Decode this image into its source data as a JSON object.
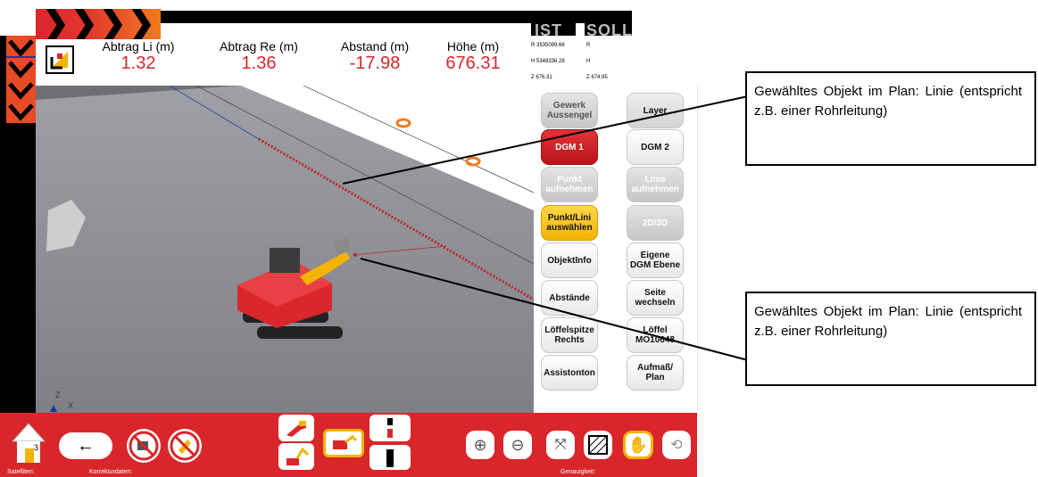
{
  "header": {
    "abtrag_li_label": "Abtrag Li (m)",
    "abtrag_li_value": "1.32",
    "abtrag_re_label": "Abtrag Re (m)",
    "abtrag_re_value": "1.36",
    "abstand_label": "Abstand (m)",
    "abstand_value": "-17.98",
    "hoehe_label": "Höhe (m)",
    "hoehe_value": "676.31"
  },
  "ist_soll": {
    "ist_label": "IST",
    "soll_label": "SOLL",
    "ist_r": "R 3535099.66",
    "ist_h": "H 5348336.28",
    "ist_z": "Z 676.31",
    "soll_r": "R",
    "soll_h": "H",
    "soll_z": "Z 674.95"
  },
  "view": {
    "axis_z": "Z",
    "axis_x": "X"
  },
  "panel": {
    "gewerk": "Gewerk Aussengel",
    "layer": "Layer",
    "dgm1": "DGM 1",
    "dgm2": "DGM 2",
    "punkt_aufnehmen": "Punkt aufnehmen",
    "linie_aufnehmen": "Linie aufnehmen",
    "punkt_linie": "Punkt/Lini auswählen",
    "view_2d3d": "2D/3D",
    "objektinfo": "ObjektInfo",
    "eigene_dgm": "Eigene DGM Ebene",
    "abstaende": "Abstände",
    "seite_wechseln": "Seite wechseln",
    "loeffelspitze": "Löffelspitze Rechts",
    "loeffel": "Löffel MO10648",
    "assistonton": "Assistonton",
    "aufmass": "Aufmaß/ Plan"
  },
  "statusbar": {
    "satelliten": "Satelliten:",
    "korrekturdaten": "Korrekturdaten:",
    "genauigkeit": "Genauigkeit:"
  },
  "toolbar": {
    "home_badge": "3"
  },
  "callouts": {
    "top": "Gewähltes Objekt im Plan: Linie (entspricht z.B. einer Rohrleitung)",
    "bottom": "Gewähltes Objekt im Plan: Linie (entspricht z.B. einer Rohrleitung)"
  },
  "colors": {
    "accent_red": "#d9262b",
    "highlight_yellow": "#f2b400",
    "value_red": "#d9262b"
  }
}
